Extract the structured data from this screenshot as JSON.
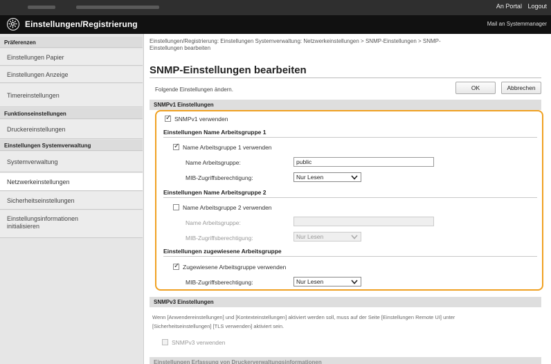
{
  "topbar": {
    "portal_link": "An Portal",
    "logout_link": "Logout"
  },
  "header": {
    "title": "Einstellungen/Registrierung",
    "mail_link": "Mail an Systemmanager"
  },
  "sidebar": {
    "items": [
      {
        "label": "Präferenzen",
        "type": "head"
      },
      {
        "label": "Einstellungen Papier",
        "type": "link"
      },
      {
        "label": "Einstellungen Anzeige",
        "type": "link"
      },
      {
        "label": "Timereinstellungen",
        "type": "link"
      },
      {
        "label": "Funktionseinstellungen",
        "type": "head"
      },
      {
        "label": "Druckereinstellungen",
        "type": "link"
      },
      {
        "label": "Einstellungen Systemverwaltung",
        "type": "head"
      },
      {
        "label": "Systemverwaltung",
        "type": "link"
      },
      {
        "label": "Netzwerkeinstellungen",
        "type": "link",
        "active": true
      },
      {
        "label": "Sicherheitseinstellungen",
        "type": "link"
      },
      {
        "label": "Einstellungsinformationen",
        "label2": "initialisieren",
        "type": "link"
      }
    ]
  },
  "main": {
    "breadcrumb_line1": "Einstellungen/Registrierung: Einstellungen Systemverwaltung: Netzwerkeinstellungen > SNMP-Einstellungen > SNMP-",
    "breadcrumb_line2": "Einstellungen bearbeiten",
    "page_title": "SNMP-Einstellungen bearbeiten",
    "instruction": "Folgende Einstellungen ändern.",
    "ok_button": "OK",
    "cancel_button": "Abbrechen",
    "snmpv1": {
      "section_title": "SNMPv1 Einstellungen",
      "use_label": "SNMPv1 verwenden",
      "use_checked": true,
      "community1": {
        "heading": "Einstellungen Name Arbeitsgruppe 1",
        "use_label": "Name Arbeitsgruppe 1 verwenden",
        "use_checked": true,
        "name_label": "Name Arbeitsgruppe:",
        "name_value": "public",
        "mib_label": "MIB-Zugriffsberechtigung:",
        "mib_value": "Nur Lesen"
      },
      "community2": {
        "heading": "Einstellungen Name Arbeitsgruppe 2",
        "use_label": "Name Arbeitsgruppe 2 verwenden",
        "use_checked": false,
        "name_label": "Name Arbeitsgruppe:",
        "name_value": "",
        "mib_label": "MIB-Zugriffsberechtigung:",
        "mib_value": "Nur Lesen"
      },
      "dedicated": {
        "heading": "Einstellungen zugewiesene Arbeitsgruppe",
        "use_label": "Zugewiesene Arbeitsgruppe verwenden",
        "use_checked": true,
        "mib_label": "MIB-Zugriffsberechtigung:",
        "mib_value": "Nur Lesen"
      }
    },
    "snmpv3": {
      "section_title": "SNMPv3 Einstellungen",
      "note_line1": "Wenn [Anwendereinstellungen] und [Kontexteinstellungen] aktiviert werden soll, muss auf der Seite [Einstellungen Remote UI] unter",
      "note_line2": "[Sicherheitseinstellungen] [TLS verwenden] aktiviert sein.",
      "use_label": "SNMPv3 verwenden",
      "use_checked": false
    },
    "next_section_title": "Einstellungen Erfassung von Druckerverwaltungsinformationen"
  },
  "colors": {
    "highlight": "#f0a020",
    "header_bg": "#111111",
    "topbar_bg": "#2f2f2f",
    "sidebar_bg": "#e6e6e6"
  }
}
